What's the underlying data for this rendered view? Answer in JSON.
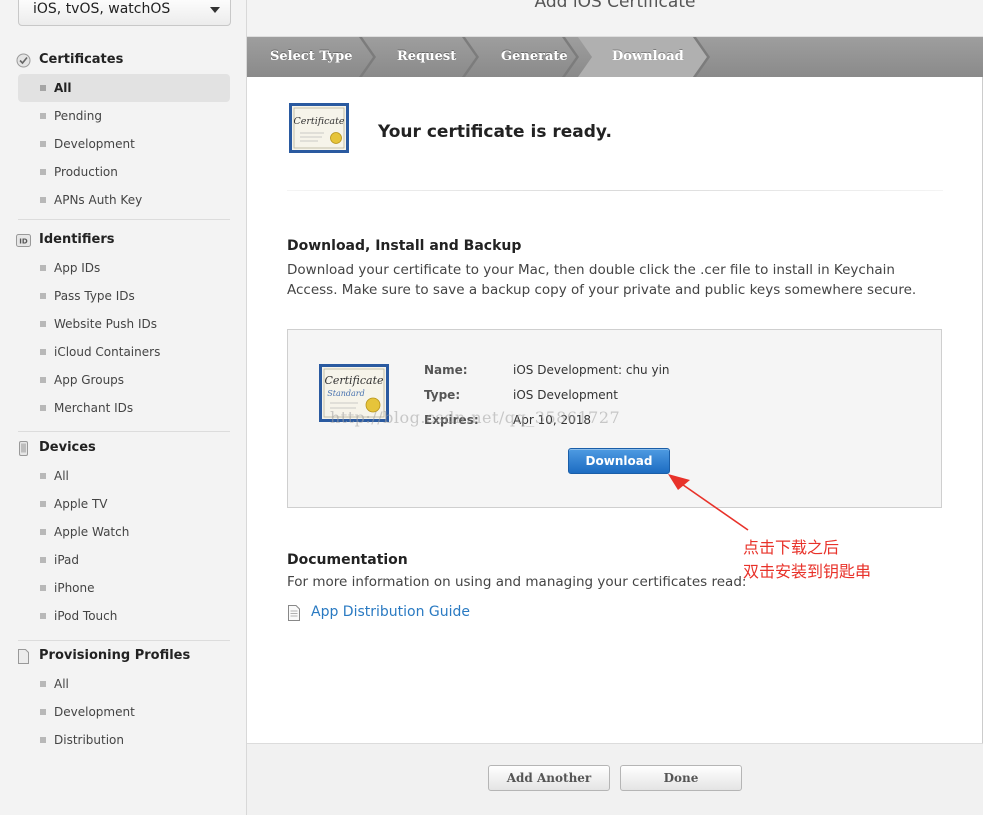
{
  "sidebar": {
    "platform": "iOS, tvOS, watchOS",
    "certificates": {
      "header": "Certificates",
      "items": [
        "All",
        "Pending",
        "Development",
        "Production",
        "APNs Auth Key"
      ]
    },
    "identifiers": {
      "header": "Identifiers",
      "icon_text": "ID",
      "items": [
        "App IDs",
        "Pass Type IDs",
        "Website Push IDs",
        "iCloud Containers",
        "App Groups",
        "Merchant IDs"
      ]
    },
    "devices": {
      "header": "Devices",
      "items": [
        "All",
        "Apple TV",
        "Apple Watch",
        "iPad",
        "iPhone",
        "iPod Touch"
      ]
    },
    "profiles": {
      "header": "Provisioning Profiles",
      "items": [
        "All",
        "Development",
        "Distribution"
      ]
    }
  },
  "main": {
    "title": "Add iOS  Certificate",
    "steps": [
      "Select Type",
      "Request",
      "Generate",
      "Download"
    ],
    "active_step": "Download",
    "ready": {
      "title": "Your certificate is ready.",
      "icon_text": "Certificate"
    },
    "download_section": {
      "title": "Download, Install and Backup",
      "description": "Download your certificate to your Mac, then double click the .cer file to install in Keychain Access. Make sure to save a backup copy of your private and public keys somewhere secure."
    },
    "certificate": {
      "icon_title": "Certificate",
      "icon_subtitle": "Standard",
      "name_label": "Name:",
      "name_value": "iOS Development: chu yin",
      "type_label": "Type:",
      "type_value": "iOS Development",
      "expires_label": "Expires:",
      "expires_value": "Apr 10, 2018",
      "download_label": "Download",
      "watermark": "http://blog.csdn.net/qq_35861727"
    },
    "documentation": {
      "title": "Documentation",
      "description": "For more information on using and managing your certificates read:",
      "link": "App Distribution Guide"
    },
    "annotation": {
      "line1": "点击下载之后",
      "line2": "双击安装到钥匙串"
    },
    "footer": {
      "add_another": "Add Another",
      "done": "Done"
    }
  },
  "colors": {
    "accent_blue": "#1d6cc2",
    "link": "#2a7ac2",
    "annotation_red": "#e8322a",
    "steps_bar": "#8a8a8a"
  }
}
